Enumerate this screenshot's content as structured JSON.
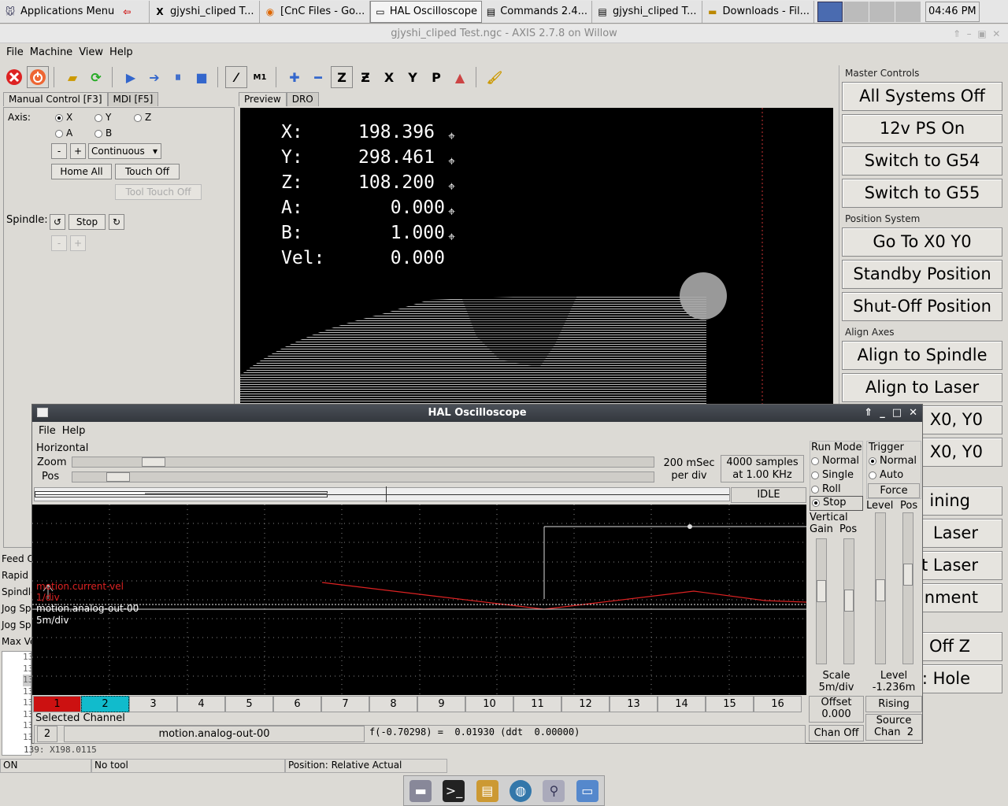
{
  "taskbar": {
    "apps_menu": "Applications Menu",
    "items": [
      "gjyshi_cliped T...",
      "[CnC Files - Go...",
      "HAL Oscilloscope",
      "Commands 2.4...",
      "gjyshi_cliped T...",
      "Downloads - Fil..."
    ],
    "clock": "04:46 PM"
  },
  "axis": {
    "title": "gjyshi_cliped Test.ngc - AXIS 2.7.8 on Willow",
    "menus": [
      "File",
      "Machine",
      "View",
      "Help"
    ],
    "tabs": {
      "manual": "Manual Control [F3]",
      "mdi": "MDI [F5]"
    },
    "axis_label": "Axis:",
    "axes": [
      "X",
      "Y",
      "Z",
      "A",
      "B"
    ],
    "minus": "-",
    "plus": "+",
    "jog_mode": "Continuous",
    "home_all": "Home All",
    "touch_off": "Touch Off",
    "tool_touch_off": "Tool Touch Off",
    "spindle_label": "Spindle:",
    "spindle_stop": "Stop",
    "left_labels": [
      "Feed O",
      "Rapid",
      "Spindle",
      "Jog Sp",
      "Jog Sp",
      "Max Ve"
    ],
    "gcode_lines": [
      "13",
      "13",
      "13",
      "13",
      "13",
      "13",
      "13",
      "13"
    ],
    "gcode_last": "139:  X198.0115",
    "view_tabs": {
      "preview": "Preview",
      "dro": "DRO"
    },
    "dro": [
      {
        "axis": "X:",
        "value": "198.396"
      },
      {
        "axis": "Y:",
        "value": "298.461"
      },
      {
        "axis": "Z:",
        "value": "108.200"
      },
      {
        "axis": "A:",
        "value": "0.000"
      },
      {
        "axis": "B:",
        "value": "1.000"
      },
      {
        "axis": "Vel:",
        "value": "0.000"
      }
    ],
    "status": {
      "state": "ON",
      "tool": "No tool",
      "position": "Position: Relative Actual"
    }
  },
  "right_panel": {
    "master_controls": "Master Controls",
    "master_buttons": [
      "All Systems Off",
      "12v PS On",
      "Switch to G54",
      "Switch to G55"
    ],
    "position_system": "Position System",
    "position_buttons": [
      "Go To X0 Y0",
      "Standby Position",
      "Shut-Off Position"
    ],
    "align_axes": "Align Axes",
    "align_buttons": [
      "Align to Spindle",
      "Align to Laser"
    ],
    "partial_buttons": [
      "X0, Y0",
      "X0, Y0",
      "ining",
      "Laser",
      "ut Laser",
      "ignment",
      "Off Z",
      ": Hole"
    ]
  },
  "scope": {
    "title": "HAL Oscilloscope",
    "menus": [
      "File",
      "Help"
    ],
    "horizontal": "Horizontal",
    "zoom": "Zoom",
    "pos": "Pos",
    "rate_line1": "200 mSec",
    "rate_line2": "per div",
    "samples_line1": "4000 samples",
    "samples_line2": "at 1.00 KHz",
    "state": "IDLE",
    "run_mode": "Run Mode",
    "run_options": [
      "Normal",
      "Single",
      "Roll",
      "Stop"
    ],
    "trigger": "Trigger",
    "trigger_options": [
      "Normal",
      "Auto"
    ],
    "force": "Force",
    "level": "Level",
    "pos_label": "Pos",
    "vertical": "Vertical",
    "gain": "Gain",
    "vpos": "Pos",
    "scale_label": "Scale",
    "scale_value": "5m/div",
    "offset_label": "Offset",
    "offset_value": "0.000",
    "chan_off": "Chan Off",
    "level_label": "Level",
    "level_value": "-1.236m",
    "rising": "Rising",
    "source_label": "Source",
    "source_value": "Chan  2",
    "trace1_name": "motion.current-vel",
    "trace1_scale": "1/div",
    "trace2_name": "motion.analog-out-00",
    "trace2_scale": "5m/div",
    "channels": [
      "1",
      "2",
      "3",
      "4",
      "5",
      "6",
      "7",
      "8",
      "9",
      "10",
      "11",
      "12",
      "13",
      "14",
      "15",
      "16"
    ],
    "selected_channel": "Selected Channel",
    "selected_num": "2",
    "selected_name": "motion.analog-out-00",
    "readout": "f(-0.70298) =  0.01930 (ddt  0.00000)",
    "colors": {
      "ch1": "#cc1111",
      "ch2": "#11bbcc"
    }
  }
}
